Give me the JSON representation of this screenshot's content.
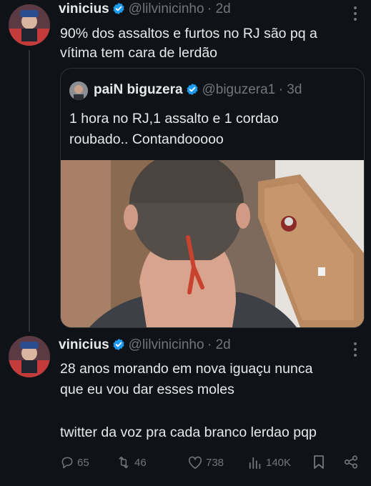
{
  "tweet1": {
    "name": "vinicius",
    "handle": "@lilvinicinho",
    "time": "· 2d",
    "text_line1": "90% dos assaltos e furtos no RJ são pq a",
    "text_line2": "vítima tem cara de lerdão"
  },
  "quote": {
    "name": "paiN biguzera",
    "handle": "@biguzera1",
    "time": "· 3d",
    "text_line1": "1 hora no RJ,1 assalto e 1 cordao",
    "text_line2": "roubado.. Contandooooo"
  },
  "tweet2": {
    "name": "vinicius",
    "handle": "@lilvinicinho",
    "time": "· 2d",
    "text_line1": "28 anos morando em nova iguaçu nunca",
    "text_line2": "que eu vou dar esses moles",
    "text_line3": "twitter da voz pra cada branco lerdao pqp"
  },
  "actions": {
    "replies": "65",
    "reposts": "46",
    "likes": "738",
    "views": "140K"
  },
  "colors": {
    "background": "#0f1217",
    "text": "#e7e9ea",
    "muted": "#71767b",
    "verified": "#1d9bf0"
  },
  "icons": [
    "verified-icon",
    "more-icon",
    "reply-icon",
    "repost-icon",
    "like-icon",
    "views-icon",
    "bookmark-icon",
    "share-icon"
  ]
}
